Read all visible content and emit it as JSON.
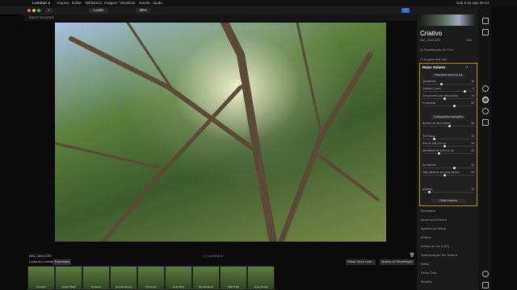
{
  "menubar": {
    "apple": "",
    "app": "Luminar 4",
    "items": [
      "Arquivo",
      "Editar",
      "Biblioteca",
      "Imagem",
      "Visualizar",
      "Janela",
      "Ajuda"
    ],
    "clock": "Sab 8 de ago 09:44"
  },
  "toolbar": {
    "looks_label": "Looks",
    "zoom": "35%",
    "tabs": [
      "Biblioteca",
      "Info",
      "Editar"
    ],
    "active_tab": "Editar"
  },
  "header": {
    "breadcrumb": "RAIOS SOLARES"
  },
  "photo_caption": "IMG_3344.CR2",
  "filmstrip": {
    "tabs": [
      "Looks do Luminar",
      "Essenciais"
    ],
    "save_look": "Salvar Novo Look...",
    "sync_label": "Ajustes de Redefinição",
    "thumbs": [
      "Retratos",
      "Classic B&W",
      "Enhance",
      "Drop Enhancer",
      "Chromatic",
      "Gold Shop",
      "Sky Enhancer",
      "B&W & Bu",
      "Super Strata"
    ]
  },
  "panel": {
    "title": "Criativo",
    "filename": "IMG_3344.CR2",
    "iso": "800",
    "sky_replace": "AI Substituição do Céu",
    "ai_augmented": "AI Augmented Sky",
    "tool_title": "Raios Solares",
    "place_center": "Posicionar centro do sol",
    "sliders_top": [
      {
        "label": "Quantidade",
        "value": "35"
      },
      {
        "label": "Sobrepor Luzes",
        "value": "0"
      },
      {
        "label": "Comprimento dos raios solares",
        "value": "40"
      },
      {
        "label": "Penetração",
        "value": "60"
      }
    ],
    "advanced_label": "Configurações avançadas",
    "sliders_mid": [
      {
        "label": "Número de raios solares",
        "value": "50"
      },
      {
        "label": "Sol Radius",
        "value": "20"
      },
      {
        "label": "Raio do brilho do sol",
        "value": "40"
      },
      {
        "label": "Quantidade de brilho do sol",
        "value": "30"
      },
      {
        "label": "Sol Warmth",
        "value": "20"
      },
      {
        "label": "Valor aleatório dos raios solares",
        "value": "40"
      },
      {
        "label": "Aleatório",
        "value": "10"
      }
    ],
    "edit_mask": "Editar máscara",
    "tools_below": [
      "Dramático",
      "Aparência Mística",
      "Aparência Gélida",
      "Místico",
      "Estilos de cor (LUT)",
      "Sobreposição De Textura",
      "Brilho",
      "Filme Grão",
      "Retalho"
    ]
  },
  "colors": {
    "accent": "#2f6ad9",
    "highlight_border": "#b58a2c"
  }
}
